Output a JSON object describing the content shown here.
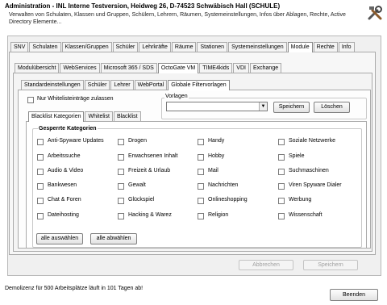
{
  "app": {
    "title": "Administration - INL Interne Testversion, Heidweg 26, D-74523 Schwäbisch Hall (SCHULE)",
    "description": "Verwalten von Schulaten, Klassen und Gruppen, Schülern, Lehrern, Räumen, Systemeinstellungen, Infos über Ablagen, Rechte, Active Directory Elemente..."
  },
  "icons": {
    "tools": "tools-icon",
    "dropdown": "chevron-down-icon"
  },
  "main_tabs": [
    "SNV",
    "Schulaten",
    "Klassen/Gruppen",
    "Schüler",
    "Lehrkräfte",
    "Räume",
    "Stationen",
    "Systemeinstellungen",
    "Module",
    "Rechte",
    "Info"
  ],
  "module_tabs": [
    "Modulübersicht",
    "WebServices",
    "Microsoft 365 / SDS",
    "OctoGate VM",
    "TIME4kids",
    "VDI",
    "Exchange"
  ],
  "octogate_tabs": [
    "Standardeinstellungen",
    "Schüler",
    "Lehrer",
    "WebPortal",
    "Globale Filtervorlagen"
  ],
  "filter": {
    "whitelist_only_label": "Nur Whitelisteinträge zulassen",
    "vorlagen_label": "Vorlagen",
    "vorlagen_value": "",
    "save_label": "Speichern",
    "delete_label": "Löschen"
  },
  "list_tabs": [
    "Blacklist Kategorien",
    "Whitelist",
    "Blacklist"
  ],
  "categories": {
    "heading": "Gesperrte Kategorien",
    "columns": [
      [
        "Anti-Spyware Updates",
        "Arbeitssuche",
        "Audio & Video",
        "Bankwesen",
        "Chat & Foren",
        "Dateihosting"
      ],
      [
        "Drogen",
        "Erwachsenen Inhalt",
        "Freizeit & Urlaub",
        "Gewalt",
        "Glückspiel",
        "Hacking & Warez"
      ],
      [
        "Handy",
        "Hobby",
        "Mail",
        "Nachrichten",
        "Onlineshopping",
        "Religion"
      ],
      [
        "Soziale Netzwerke",
        "Spiele",
        "Suchmaschinen",
        "Viren Spyware Dialer",
        "Werbung",
        "Wissenschaft"
      ]
    ],
    "select_all_label": "alle auswählen",
    "deselect_all_label": "alle abwählen"
  },
  "footer": {
    "cancel_label": "Abbrechen",
    "save_label": "Speichern",
    "status": "Demolizenz für 500 Arbeitsplätze läuft in 101 Tagen ab!",
    "exit_label": "Beenden"
  }
}
